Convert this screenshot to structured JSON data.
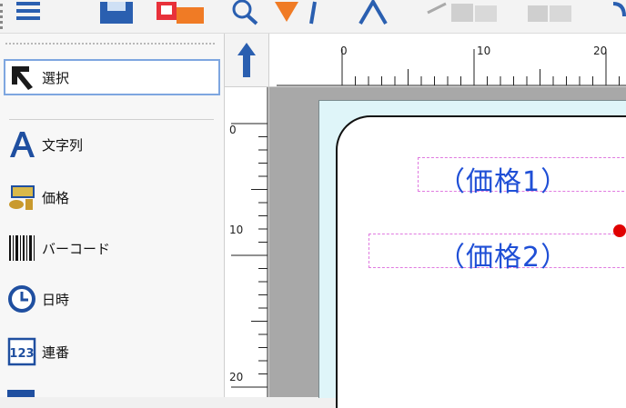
{
  "toolbar": {
    "buttons": [
      "list-icon",
      "save-icon",
      "image-icon",
      "zoom-icon",
      "pointer-icon",
      "text-tool-icon",
      "barcode-icon",
      "grid-icon",
      "rotate-icon"
    ]
  },
  "palette": {
    "tools": [
      {
        "label": "選択",
        "icon": "select-arrow-icon"
      },
      {
        "label": "文字列",
        "icon": "text-a-icon"
      },
      {
        "label": "価格",
        "icon": "coins-icon"
      },
      {
        "label": "バーコード",
        "icon": "barcode-icon"
      },
      {
        "label": "日時",
        "icon": "clock-icon"
      },
      {
        "label": "連番",
        "icon": "serial-123-icon"
      }
    ]
  },
  "ruler": {
    "horizontal": [
      "0",
      "10",
      "20"
    ],
    "vertical": [
      "0",
      "10",
      "20"
    ]
  },
  "design": {
    "fields": [
      "（価格1）",
      "（価格2）"
    ]
  },
  "colors": {
    "selection": "#7ea6e0",
    "field_text": "#1f4fd6",
    "field_border": "#e07ae0",
    "paper": "#dff5f9",
    "handle": "#e00000"
  }
}
